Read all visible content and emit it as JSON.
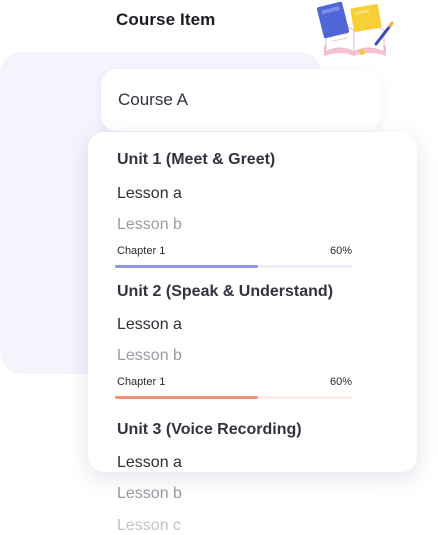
{
  "header": {
    "title": "Course Item"
  },
  "course": {
    "name": "Course A"
  },
  "colors": {
    "accent_blue": "#8d95e4",
    "accent_orange": "#f2907a"
  },
  "units": [
    {
      "title": "Unit 1 (Meet & Greet)",
      "lessons": [
        "Lesson a",
        "Lesson b"
      ],
      "progress": {
        "label": "Chapter 1",
        "value": "60%",
        "fraction": 0.6
      }
    },
    {
      "title": "Unit 2 (Speak & Understand)",
      "lessons": [
        "Lesson a",
        "Lesson b"
      ],
      "progress": {
        "label": "Chapter 1",
        "value": "60%",
        "fraction": 0.6
      }
    },
    {
      "title": "Unit 3 (Voice Recording)",
      "lessons": [
        "Lesson a",
        "Lesson b",
        "Lesson c"
      ]
    }
  ]
}
